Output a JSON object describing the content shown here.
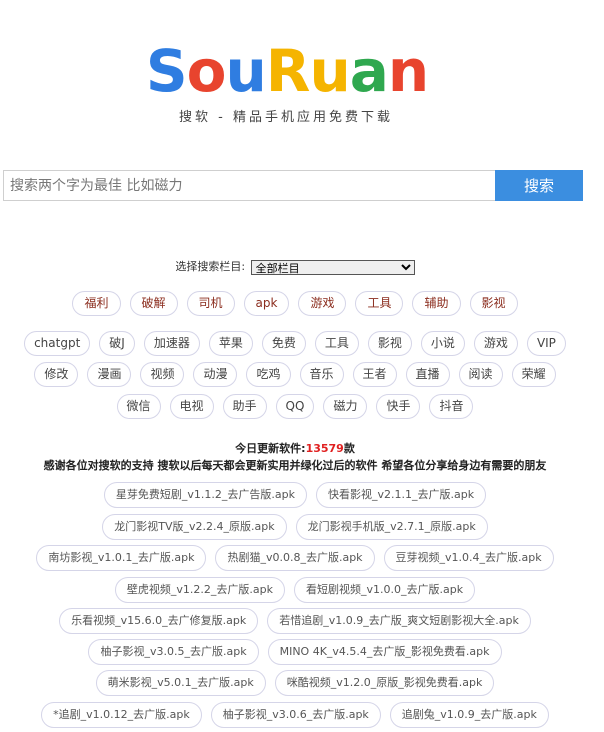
{
  "logo": {
    "letters": [
      {
        "ch": "S",
        "color": "#2f7de1"
      },
      {
        "ch": "o",
        "color": "#e8442e"
      },
      {
        "ch": "u",
        "color": "#2f7de1"
      },
      {
        "ch": "R",
        "color": "#f5b400"
      },
      {
        "ch": "u",
        "color": "#f5b400"
      },
      {
        "ch": "a",
        "color": "#2fa84f"
      },
      {
        "ch": "n",
        "color": "#e8442e"
      }
    ],
    "tagline": "搜软 - 精品手机应用免费下载"
  },
  "search": {
    "placeholder": "搜索两个字为最佳 比如磁力",
    "button_label": "搜索"
  },
  "category_select": {
    "label": "选择搜索栏目:",
    "selected": "全部栏目"
  },
  "primary_tags": [
    "福利",
    "破解",
    "司机",
    "apk",
    "游戏",
    "工具",
    "辅助",
    "影视"
  ],
  "tag_rows": [
    [
      "chatgpt",
      "破J",
      "加速器",
      "苹果",
      "免费",
      "工具",
      "影视",
      "小说",
      "游戏",
      "VIP"
    ],
    [
      "修改",
      "漫画",
      "视频",
      "动漫",
      "吃鸡",
      "音乐",
      "王者",
      "直播",
      "阅读",
      "荣耀"
    ],
    [
      "微信",
      "电视",
      "助手",
      "QQ",
      "磁力",
      "快手",
      "抖音"
    ]
  ],
  "stats": {
    "label": "今日更新软件:",
    "count": "13579",
    "unit": "款",
    "thanks": "感谢各位对搜软的支持 搜软以后每天都会更新实用并绿化过后的软件 希望各位分享给身边有需要的朋友"
  },
  "app_rows": [
    [
      "星芽免费短剧_v1.1.2_去广告版.apk",
      "快看影视_v2.1.1_去广版.apk"
    ],
    [
      "龙门影视TV版_v2.2.4_原版.apk",
      "龙门影视手机版_v2.7.1_原版.apk"
    ],
    [
      "南坊影视_v1.0.1_去广版.apk",
      "热剧猫_v0.0.8_去广版.apk",
      "豆芽视频_v1.0.4_去广版.apk"
    ],
    [
      "壁虎视频_v1.2.2_去广版.apk",
      "看短剧视频_v1.0.0_去广版.apk"
    ],
    [
      "乐看视频_v15.6.0_去广修复版.apk",
      "若惜追剧_v1.0.9_去广版_爽文短剧影视大全.apk"
    ],
    [
      "柚子影视_v3.0.5_去广版.apk",
      "MINO 4K_v4.5.4_去广版_影视免费看.apk"
    ],
    [
      "萌米影视_v5.0.1_去广版.apk",
      "咪酷视频_v1.2.0_原版_影视免费看.apk"
    ],
    [
      "*追剧_v1.0.12_去广版.apk",
      "柚子影视_v3.0.6_去广版.apk",
      "追剧兔_v1.0.9_去广版.apk"
    ]
  ]
}
